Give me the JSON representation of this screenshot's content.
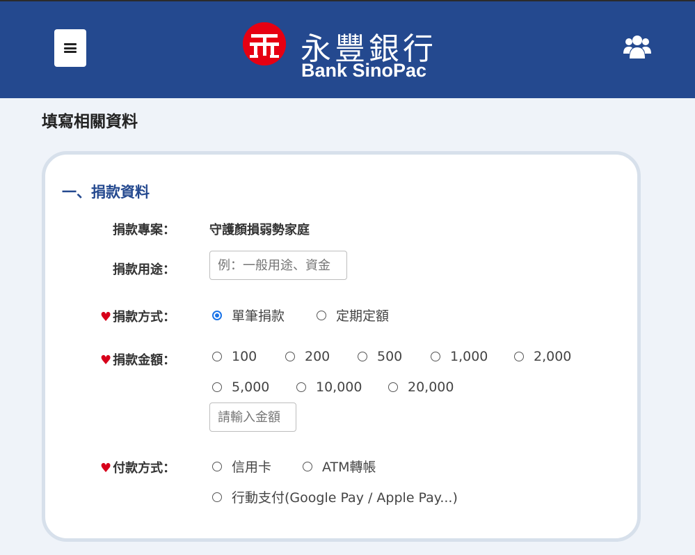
{
  "header": {
    "menu_icon": "hamburger-menu-icon",
    "brand_name_zh": "永豐銀行",
    "brand_name_en": "Bank SinoPac",
    "members_icon": "users-group-icon",
    "background_color": "#24498f",
    "logo_color": "#e60012"
  },
  "page": {
    "title": "填寫相關資料"
  },
  "section1": {
    "title": "一、捐款資料",
    "project": {
      "label": "捐款專案：",
      "value": "守護顏損弱勢家庭"
    },
    "purpose": {
      "label": "捐款用途：",
      "placeholder": "例：一般用途、資金"
    },
    "method": {
      "required_mark": "♥",
      "label": "捐款方式：",
      "options": [
        "單筆捐款",
        "定期定額"
      ],
      "selected": "單筆捐款"
    },
    "amount": {
      "required_mark": "♥",
      "label": "捐款金額：",
      "options": [
        "100",
        "200",
        "500",
        "1,000",
        "2,000",
        "5,000",
        "10,000",
        "20,000"
      ],
      "custom_placeholder": "請輸入金額"
    },
    "payment": {
      "required_mark": "♥",
      "label": "付款方式：",
      "options": [
        "信用卡",
        "ATM轉帳",
        "行動支付(Google Pay / Apple Pay...)"
      ]
    }
  },
  "colors": {
    "accent": "#24498f",
    "required": "#d7001a",
    "radio_selected": "#1a73e8"
  }
}
